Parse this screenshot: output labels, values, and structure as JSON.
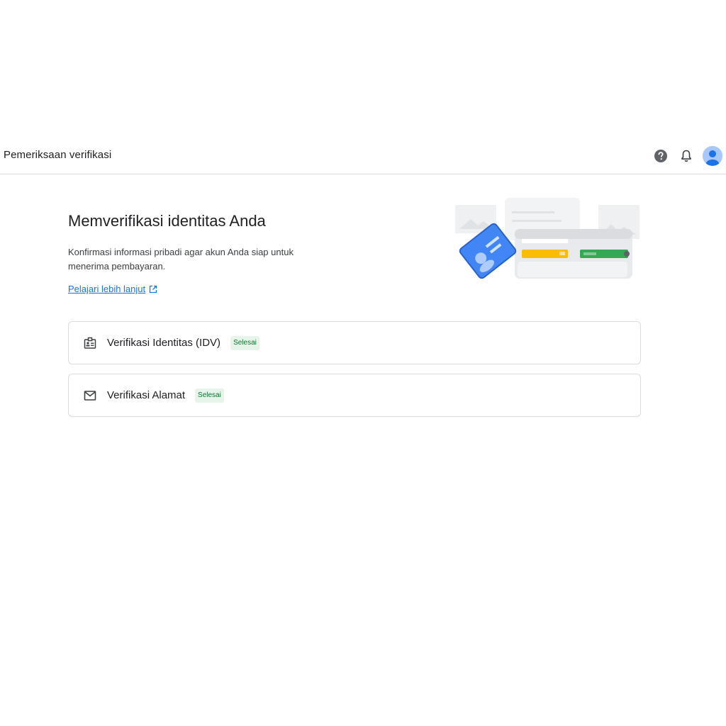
{
  "header": {
    "title": "Pemeriksaan verifikasi",
    "icons": [
      "help-icon",
      "bell-icon",
      "avatar"
    ]
  },
  "hero": {
    "title": "Memverifikasi identitas Anda",
    "description": "Konfirmasi informasi pribadi agar akun Anda siap untuk menerima pembayaran.",
    "link": "Pelajari lebih lanjut"
  },
  "items": [
    {
      "label": "Verifikasi Identitas (IDV)",
      "status": "Selesai",
      "icon": "id-card-icon"
    },
    {
      "label": "Verifikasi Alamat",
      "status": "Selesai",
      "icon": "mail-icon"
    }
  ],
  "colors": {
    "accent": "#1a73e8",
    "badge_bg": "#e6f4ea",
    "badge_text": "#137333",
    "divider": "#dadce0"
  }
}
